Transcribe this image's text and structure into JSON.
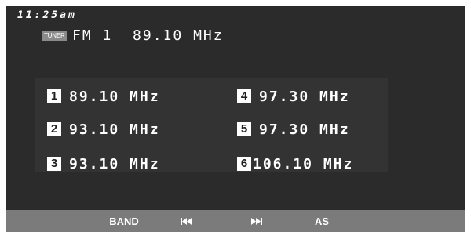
{
  "clock": "11:25am",
  "source_badge": "TUNER",
  "current": {
    "band": "FM 1",
    "frequency": "89.10 MHz"
  },
  "presets": [
    {
      "number": "1",
      "frequency": "89.10 MHz"
    },
    {
      "number": "2",
      "frequency": "93.10 MHz"
    },
    {
      "number": "3",
      "frequency": "93.10 MHz"
    },
    {
      "number": "4",
      "frequency": "97.30 MHz"
    },
    {
      "number": "5",
      "frequency": "97.30 MHz"
    },
    {
      "number": "6",
      "frequency": "106.10 MHz"
    }
  ],
  "toolbar": {
    "band_label": "BAND",
    "prev_icon": "seek-back-icon",
    "next_icon": "seek-forward-icon",
    "as_label": "AS"
  },
  "colors": {
    "panel": "#2b2b2b",
    "preset_area": "#333333",
    "toolbar": "#7b7b7b",
    "text": "#ffffff"
  }
}
